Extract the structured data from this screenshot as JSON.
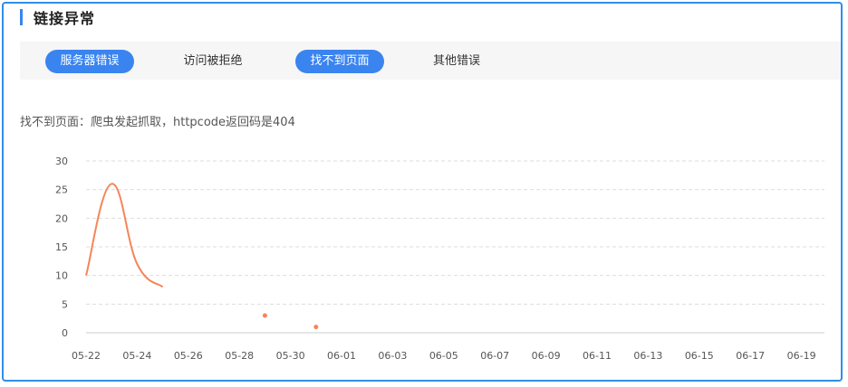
{
  "section": {
    "title": "链接异常"
  },
  "tabs": [
    {
      "label": "服务器错误",
      "active": true
    },
    {
      "label": "访问被拒绝",
      "active": false
    },
    {
      "label": "找不到页面",
      "active": true
    },
    {
      "label": "其他错误",
      "active": false
    }
  ],
  "description": "找不到页面：爬虫发起抓取，httpcode返回码是404",
  "colors": {
    "accent": "#3a84f0",
    "line": "#f5855a",
    "border": "#2f8fe8"
  },
  "chart_data": {
    "type": "line",
    "ylim": [
      0,
      30
    ],
    "yticks": [
      "0",
      "5",
      "10",
      "15",
      "20",
      "25",
      "30"
    ],
    "xticks": [
      "05-22",
      "05-24",
      "05-26",
      "05-28",
      "05-30",
      "06-01",
      "06-03",
      "06-05",
      "06-07",
      "06-09",
      "06-11",
      "06-13",
      "06-15",
      "06-17",
      "06-19"
    ],
    "grid": true,
    "series": [
      {
        "points": [
          {
            "x": "05-22",
            "y": 10
          },
          {
            "x": "05-23",
            "y": 26
          },
          {
            "x": "05-24",
            "y": 12
          },
          {
            "x": "05-25",
            "y": 8
          },
          {
            "x": "05-29",
            "y": 3
          },
          {
            "x": "05-31",
            "y": 1
          }
        ]
      }
    ]
  }
}
